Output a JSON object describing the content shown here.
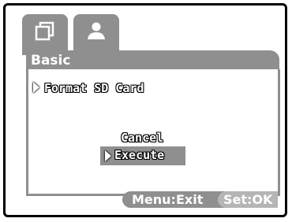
{
  "tabs": [
    {
      "icon": "image-frame-icon"
    },
    {
      "icon": "person-icon"
    }
  ],
  "menu": {
    "title": "Basic",
    "selected_item": "Format SD Card"
  },
  "dialog": {
    "options": [
      "Cancel",
      "Execute"
    ],
    "highlighted": "Execute"
  },
  "footer": {
    "menu_hint": "Menu:Exit",
    "set_hint": "Set:OK"
  },
  "colors": {
    "accent_gray": "#8f8f8f",
    "highlight_gray": "#b5b5b5"
  }
}
